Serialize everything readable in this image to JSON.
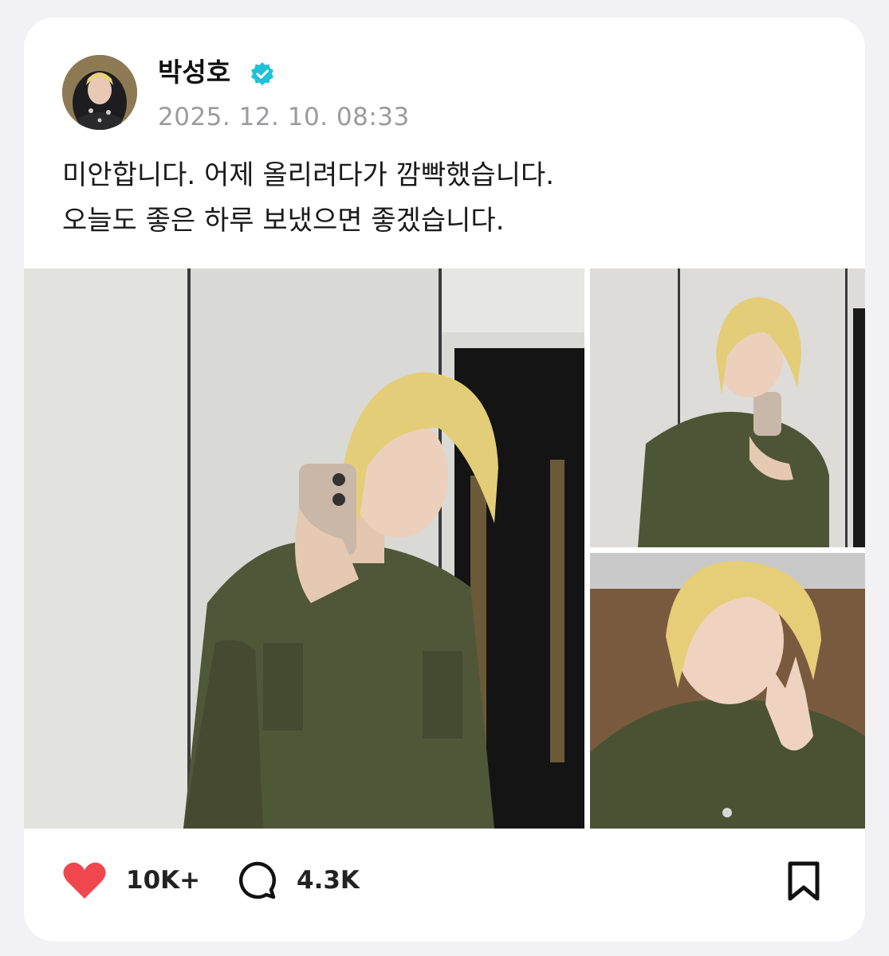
{
  "post": {
    "author": "박성호",
    "verified": true,
    "timestamp": "2025. 12. 10. 08:33",
    "text_lines": [
      "미안합니다. 어제 올리려다가 깜빡했습니다.",
      "오늘도 좋은 하루 보냈으면 좋겠습니다."
    ]
  },
  "stats": {
    "likes": "10K+",
    "comments": "4.3K"
  },
  "icons": {
    "like": "heart-icon",
    "comment": "comment-bubble-icon",
    "bookmark": "bookmark-icon",
    "verified": "verified-badge-icon"
  },
  "colors": {
    "like": "#f0474f",
    "verified": "#1ec3d6",
    "timestamp": "#9b9b9f"
  }
}
